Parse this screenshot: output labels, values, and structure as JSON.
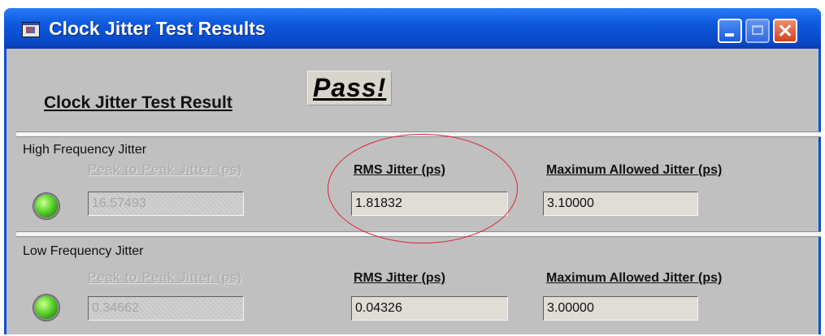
{
  "window": {
    "title": "Clock Jitter Test Results"
  },
  "header": {
    "label": "Clock Jitter Test Result",
    "result": "Pass!"
  },
  "high_frequency": {
    "section_label": "High Frequency Jitter",
    "peak_label": "Peak to Peak Jitter (ps)",
    "peak_value": "16.57493",
    "rms_label": "RMS Jitter (ps)",
    "rms_value": "1.81832",
    "max_label": "Maximum Allowed  Jitter (ps)",
    "max_value": "3.10000"
  },
  "low_frequency": {
    "section_label": "Low Frequency Jitter",
    "peak_label": "Peak to Peak Jitter (ps)",
    "peak_value": "0.34662",
    "rms_label": "RMS Jitter (ps)",
    "rms_value": "0.04326",
    "max_label": "Maximum Allowed  Jitter (ps)",
    "max_value": "3.00000"
  },
  "colors": {
    "titlebar": "#0a4fd9",
    "panel": "#c0c0c0",
    "led_pass": "#4cc21d",
    "annotation_circle": "#e0203a"
  },
  "icons": [
    "app-icon",
    "minimize-icon",
    "maximize-icon",
    "close-icon",
    "status-led-icon"
  ]
}
